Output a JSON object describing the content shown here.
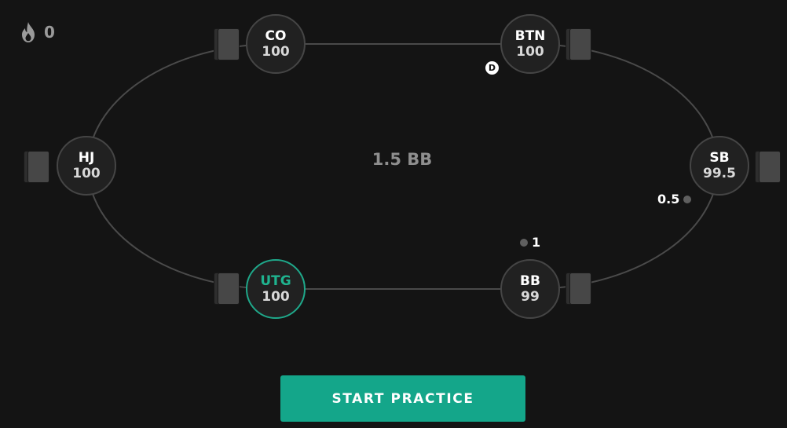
{
  "streak": {
    "icon": "flame-icon",
    "count": "0"
  },
  "pot": {
    "label": "1.5 BB"
  },
  "seats": {
    "co": {
      "position": "CO",
      "stack": "100"
    },
    "btn": {
      "position": "BTN",
      "stack": "100"
    },
    "hj": {
      "position": "HJ",
      "stack": "100"
    },
    "sb": {
      "position": "SB",
      "stack": "99.5"
    },
    "utg": {
      "position": "UTG",
      "stack": "100"
    },
    "bb": {
      "position": "BB",
      "stack": "99"
    }
  },
  "bets": {
    "sb": {
      "amount": "0.5"
    },
    "bb": {
      "amount": "1"
    }
  },
  "dealer_button": {
    "label": "D"
  },
  "actions": {
    "start_label": "START PRACTICE"
  },
  "colors": {
    "background": "#141414",
    "accent": "#14a68a",
    "hero_ring": "#1fa88a",
    "table_line": "#4a4a4a",
    "seat_fill": "#212121"
  }
}
